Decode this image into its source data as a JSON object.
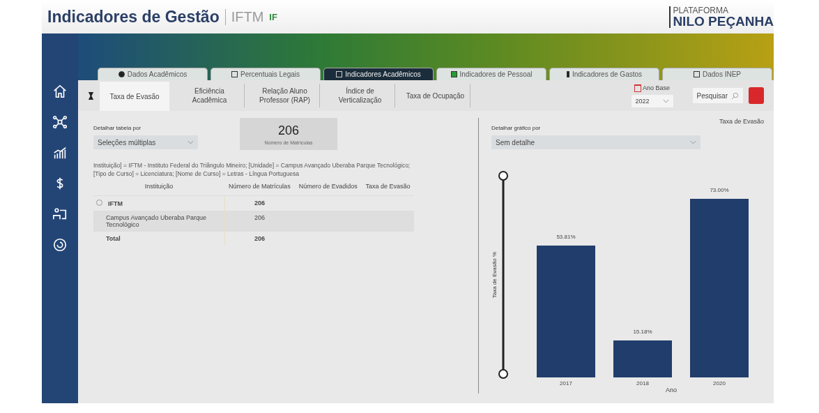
{
  "header": {
    "title": "Indicadores de Gestão",
    "subtitle": "IFTM",
    "logo_text": "IF",
    "platform_top": "PLATAFORMA",
    "platform_name": "NILO PEÇANHA"
  },
  "tabs": [
    {
      "label": "Dados Acadêmicos",
      "selected": false
    },
    {
      "label": "Percentuais Legais",
      "selected": false
    },
    {
      "label": "Indicadores Acadêmicos",
      "selected": true
    },
    {
      "label": "Indicadores de Pessoal",
      "selected": false
    },
    {
      "label": "Indicadores de Gastos",
      "selected": false
    },
    {
      "label": "Dados INEP",
      "selected": false
    }
  ],
  "subtabs": [
    {
      "label": "Taxa de Evasão",
      "selected": true
    },
    {
      "label": "Eficiência Acadêmica",
      "selected": false
    },
    {
      "label": "Relação Aluno Professor (RAP)",
      "selected": false
    },
    {
      "label": "Índice de Verticalização",
      "selected": false
    },
    {
      "label": "Taxa de Ocupação",
      "selected": false
    }
  ],
  "year_filter": {
    "label": "Ano Base",
    "value": "2022"
  },
  "search_button": {
    "label": "Pesquisar"
  },
  "table_filter": {
    "label": "Detalhar tabela por",
    "value": "Seleções múltiplas"
  },
  "kpi": {
    "value": "206",
    "label": "Número de Matrículas"
  },
  "filter_summary": "Instituição] = IFTM - Instituto Federal do Triângulo Mineiro; [Unidade] = Campus Avançado Uberaba Parque Tecnológico; [Tipo de Curso] = Licenciatura; [Nome de Curso] = Letras - Língua Portuguesa",
  "table": {
    "columns": [
      "Instituição",
      "Número de Matrículas",
      "Número de Evadidos",
      "Taxa de Evasão"
    ],
    "rows": [
      {
        "kind": "group",
        "cells": [
          "IFTM",
          "206",
          "",
          ""
        ]
      },
      {
        "kind": "child",
        "cells": [
          "Campus Avançado Uberaba Parque Tecnológico",
          "206",
          "",
          ""
        ]
      },
      {
        "kind": "total",
        "cells": [
          "Total",
          "206",
          "",
          ""
        ]
      }
    ]
  },
  "chart_filter": {
    "label": "Detalhar gráfico por",
    "value": "Sem detalhe"
  },
  "chart": {
    "chart_data": {
      "type": "bar",
      "title": "Taxa de Evasão",
      "xlabel": "Ano",
      "annotations": [
        {
          "text": "Taxa de Evasão %"
        }
      ],
      "categories": [
        "2017",
        "2018",
        "2020"
      ],
      "values": [
        53.81,
        15.18,
        73.0
      ],
      "data_labels": true,
      "value_labels": [
        "53.81%",
        "15.18%",
        "73.00%"
      ]
    }
  }
}
